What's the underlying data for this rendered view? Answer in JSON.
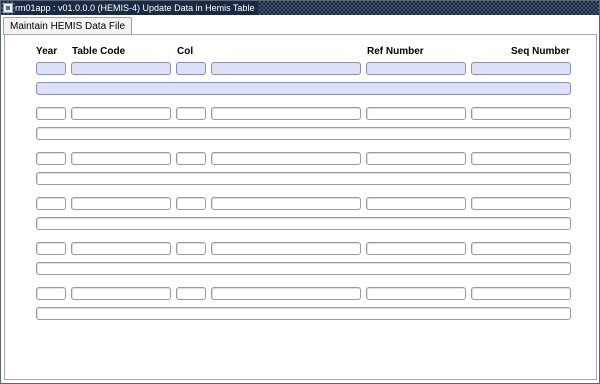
{
  "window": {
    "title": "rm01app : v01.0.0.0 (HEMIS-4) Update Data in Hemis Table"
  },
  "tabs": [
    {
      "label": "Maintain HEMIS Data File"
    }
  ],
  "columns": {
    "year": "Year",
    "table_code": "Table Code",
    "col": "Col",
    "ref_number": "Ref Number",
    "seq_number": "Seq Number"
  },
  "rows": [
    {
      "year": "",
      "table_code": "",
      "col": "",
      "col_desc": "",
      "ref_number": "",
      "seq_number": "",
      "value": ""
    },
    {
      "year": "",
      "table_code": "",
      "col": "",
      "col_desc": "",
      "ref_number": "",
      "seq_number": "",
      "value": ""
    },
    {
      "year": "",
      "table_code": "",
      "col": "",
      "col_desc": "",
      "ref_number": "",
      "seq_number": "",
      "value": ""
    },
    {
      "year": "",
      "table_code": "",
      "col": "",
      "col_desc": "",
      "ref_number": "",
      "seq_number": "",
      "value": ""
    },
    {
      "year": "",
      "table_code": "",
      "col": "",
      "col_desc": "",
      "ref_number": "",
      "seq_number": "",
      "value": ""
    },
    {
      "year": "",
      "table_code": "",
      "col": "",
      "col_desc": "",
      "ref_number": "",
      "seq_number": "",
      "value": ""
    }
  ],
  "colors": {
    "titlebar": "#1b2a44",
    "active_row_fill": "#dde1f7"
  }
}
